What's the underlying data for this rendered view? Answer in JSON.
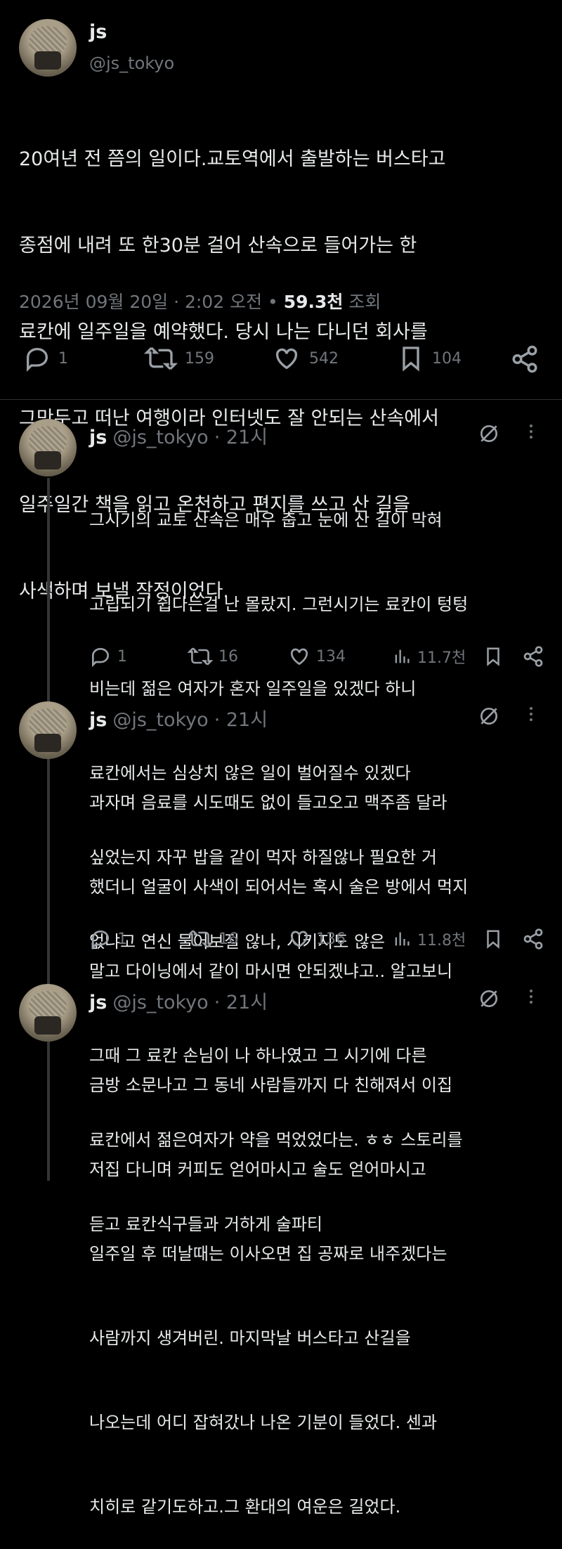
{
  "post": {
    "name": "js",
    "handle": "@js_tokyo",
    "lines": [
      "20여년 전 쯤의 일이다.교토역에서 출발하는 버스타고",
      "종점에 내려 또 한30분 걸어 산속으로 들어가는 한",
      "료칸에 일주일을 예약했다. 당시 나는 다니던 회사를",
      "그만두고 떠난 여행이라 인터넷도 잘 안되는 산속에서",
      "일주일간 책을 읽고 온천하고 편지를 쓰고 산 길을",
      "사색하며 보낼 작정이었다."
    ],
    "timestamp": "2026년 09월 20일 · 2:02 오전",
    "views_sep": " • ",
    "views": "59.3천",
    "views_label": "조회",
    "stats": {
      "replies": "1",
      "reposts": "159",
      "likes": "542",
      "bookmarks": "104"
    }
  },
  "replies": [
    {
      "name": "js",
      "handle": "@js_tokyo",
      "time": "· 21시",
      "lines": [
        "그시기의 교토 산속은 매우 춥고 눈에 산 길이 막혀",
        "고립되기 쉽다는걸 난 몰랐지. 그런시기는 료칸이 텅텅",
        "비는데 젊은 여자가 혼자 일주일을 있겠다 하니",
        "료칸에서는 심상치 않은 일이 벌어질수 있겠다",
        "싶었는지 자꾸 밥을 같이 먹자 하질않나 필요한 거",
        "없냐고 연신 물어보질 않나, 시키지도 않은"
      ],
      "stats": {
        "replies": "1",
        "reposts": "16",
        "likes": "134",
        "views": "11.7천"
      }
    },
    {
      "name": "js",
      "handle": "@js_tokyo",
      "time": "· 21시",
      "lines": [
        "과자며 음료를 시도때도 없이 들고오고 맥주좀 달라",
        "했더니 얼굴이 사색이 되어서는 혹시 술은 방에서 먹지",
        "말고 다이닝에서 같이 마시면 안되겠냐고.. 알고보니",
        "그때 그 료칸 손님이 나 하나였고 그 시기에 다른",
        "료칸에서 젊은여자가 약을 먹었었다는. ㅎㅎ 스토리를",
        "듣고 료칸식구들과 거하게 술파티"
      ],
      "stats": {
        "replies": "1",
        "reposts": "16",
        "likes": "136",
        "views": "11.8천"
      }
    },
    {
      "name": "js",
      "handle": "@js_tokyo",
      "time": "· 21시",
      "lines": [
        "금방 소문나고 그 동네 사람들까지 다 친해져서 이집",
        "저집 다니며 커피도 얻어마시고 술도 얻어마시고",
        "일주일 후 떠날때는 이사오면 집 공짜로 내주겠다는",
        "사람까지 생겨버린. 마지막날 버스타고 산길을",
        "나오는데 어디 잡혀갔나 나온 기분이 들었다. 센과",
        "치히로 같기도하고.그 환대의 여운은 길었다."
      ]
    }
  ]
}
